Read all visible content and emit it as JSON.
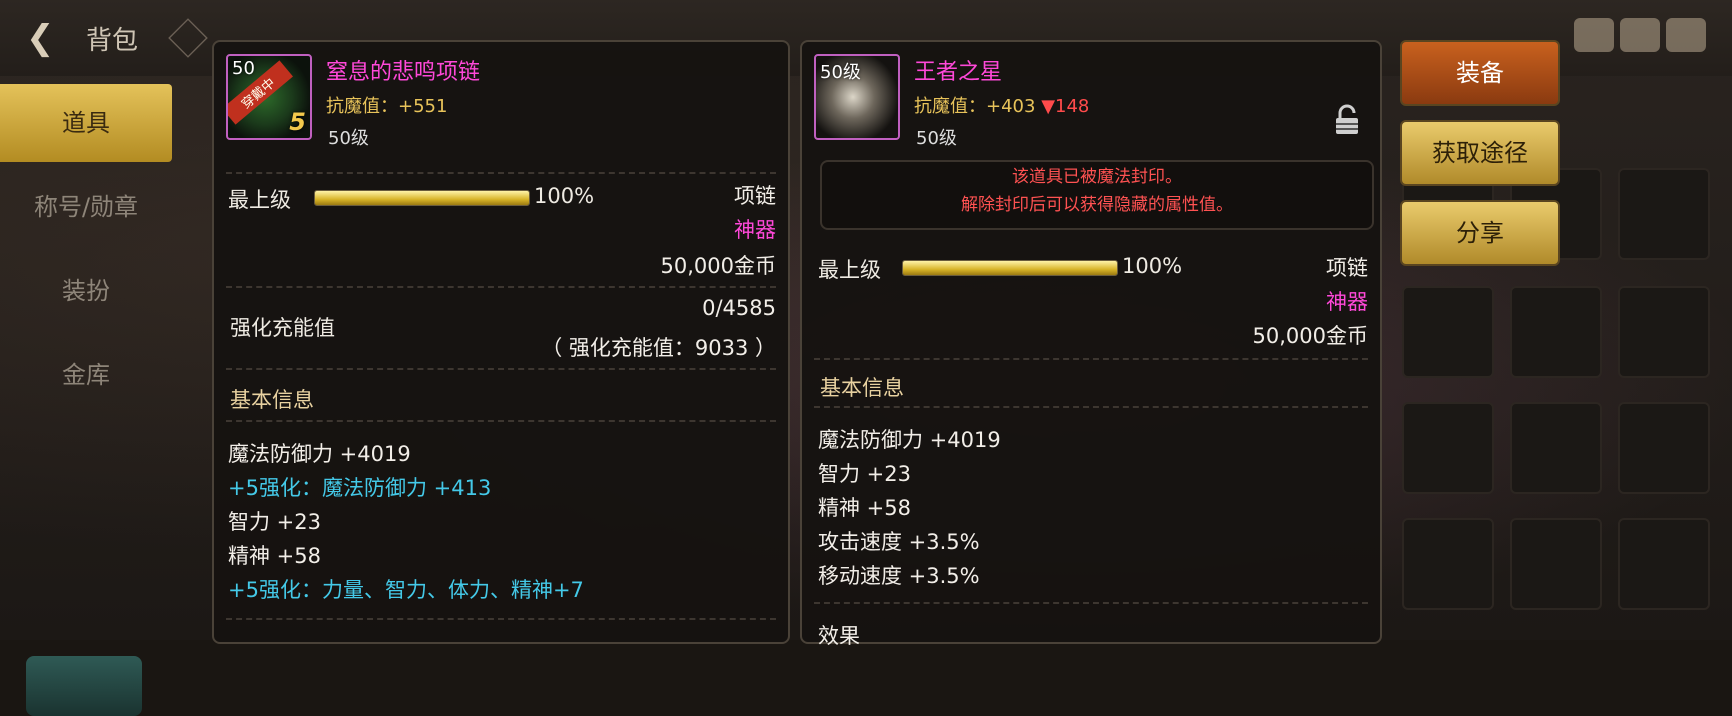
{
  "topbar": {
    "title": "背包"
  },
  "sidebar": {
    "items": [
      {
        "label": "道具",
        "active": true
      },
      {
        "label": "称号/勋章",
        "active": false
      },
      {
        "label": "装扮",
        "active": false
      },
      {
        "label": "金库",
        "active": false
      }
    ]
  },
  "left_item": {
    "icon_level": "50",
    "wearing_badge": "穿戴中",
    "enhance_badge": "5",
    "name": "窒息的悲鸣项链",
    "resist_label": "抗魔值：",
    "resist_value": "+551",
    "level": "50级",
    "grade_label": "最上级",
    "grade_percent": "100%",
    "grade_fill": 1.0,
    "type": "项链",
    "rarity": "神器",
    "price": "50,000金币",
    "charge_label": "强化充能值",
    "charge_value": "0/4585",
    "charge_total": "（ 强化充能值：9033 ）",
    "basic_info_title": "基本信息",
    "stats": [
      {
        "text": "魔法防御力 +4019",
        "color": "white"
      },
      {
        "text": "+5强化：魔法防御力 +413",
        "color": "cyan"
      },
      {
        "text": "智力 +23",
        "color": "white"
      },
      {
        "text": "精神 +58",
        "color": "white"
      },
      {
        "text": "+5强化：力量、智力、体力、精神+7",
        "color": "cyan"
      }
    ]
  },
  "right_item": {
    "icon_level": "50级",
    "name": "王者之星",
    "resist_label": "抗魔值：",
    "resist_value": "+403",
    "resist_diff": "▼148",
    "level": "50级",
    "seal_line1": "该道具已被魔法封印。",
    "seal_line2": "解除封印后可以获得隐藏的属性值。",
    "grade_label": "最上级",
    "grade_percent": "100%",
    "grade_fill": 1.0,
    "type": "项链",
    "rarity": "神器",
    "price": "50,000金币",
    "basic_info_title": "基本信息",
    "stats": [
      "魔法防御力 +4019",
      "智力 +23",
      "精神 +58",
      "攻击速度 +3.5%",
      "移动速度 +3.5%"
    ],
    "effect_title": "效果"
  },
  "buttons": {
    "equip": "装备",
    "obtain": "获取途径",
    "share": "分享"
  },
  "colors": {
    "epic_name": "#ff48d9",
    "enhance_text": "#44c9e8",
    "seal_text": "#ff5252",
    "equip_button": "#c9611e",
    "gold_button": "#eacb6c"
  }
}
